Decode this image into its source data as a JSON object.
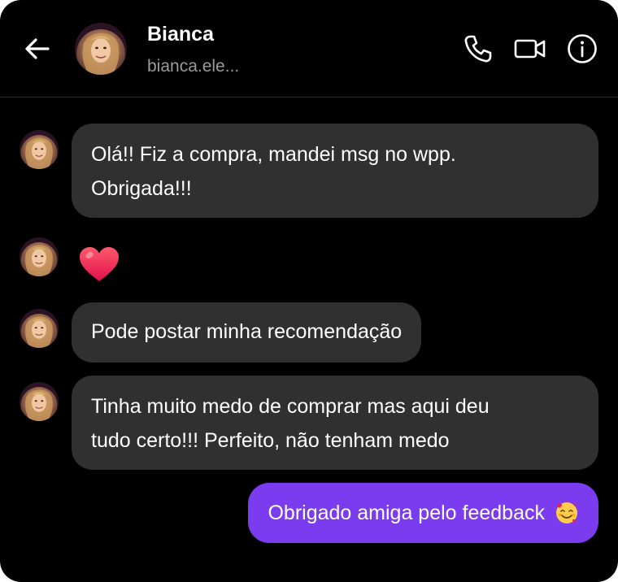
{
  "header": {
    "contact_name": "Bianca",
    "contact_handle": "bianca.ele...",
    "icons": [
      "back-arrow-icon",
      "phone-icon",
      "video-camera-icon",
      "info-icon"
    ]
  },
  "messages": [
    {
      "direction": "received",
      "type": "text",
      "text": "Olá!! Fiz a compra, mandei msg no wpp.\nObrigada!!!"
    },
    {
      "direction": "received",
      "type": "emoji",
      "emoji": "red-heart-icon"
    },
    {
      "direction": "received",
      "type": "text",
      "text": "Pode postar minha recomendação"
    },
    {
      "direction": "received",
      "type": "text",
      "text": "Tinha muito medo de comprar mas aqui deu\ntudo certo!!! Perfeito, não tenham medo"
    },
    {
      "direction": "sent",
      "type": "text",
      "text": "Obrigado amiga pelo feedback",
      "emoji": "smiling-face-with-hearts-icon"
    }
  ],
  "colors": {
    "background": "#000000",
    "received_bubble": "#303030",
    "sent_bubble": "#7b3bee",
    "text": "#ffffff",
    "secondary_text": "#9a9a9a"
  }
}
